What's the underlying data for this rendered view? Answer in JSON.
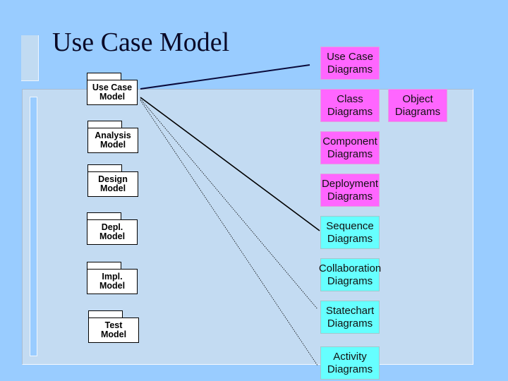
{
  "slide": {
    "title": "Use Case Model",
    "colors": {
      "background": "#99ccff",
      "panel": "#c3dbf2",
      "view_diagram": "#ff66ff",
      "behavior_diagram": "#66ffff"
    }
  },
  "models": [
    {
      "line1": "Use Case",
      "line2": "Model"
    },
    {
      "line1": "Analysis",
      "line2": "Model"
    },
    {
      "line1": "Design",
      "line2": "Model"
    },
    {
      "line1": "Depl.",
      "line2": "Model"
    },
    {
      "line1": "Impl.",
      "line2": "Model"
    },
    {
      "line1": "Test",
      "line2": "Model"
    }
  ],
  "diagrams": [
    {
      "line1": "Use Case",
      "line2": "Diagrams",
      "kind": "magenta"
    },
    {
      "line1": "Class",
      "line2": "Diagrams",
      "kind": "magenta"
    },
    {
      "line1": "Object",
      "line2": "Diagrams",
      "kind": "magenta"
    },
    {
      "line1": "Component",
      "line2": "Diagrams",
      "kind": "magenta"
    },
    {
      "line1": "Deployment",
      "line2": "Diagrams",
      "kind": "magenta"
    },
    {
      "line1": "Sequence",
      "line2": "Diagrams",
      "kind": "cyan"
    },
    {
      "line1": "Collaboration",
      "line2": "Diagrams",
      "kind": "cyan"
    },
    {
      "line1": "Statechart",
      "line2": "Diagrams",
      "kind": "cyan"
    },
    {
      "line1": "Activity",
      "line2": "Diagrams",
      "kind": "cyan"
    }
  ],
  "connections": [
    {
      "from": "Use Case Model",
      "to": "Use Case Diagrams",
      "style": "solid"
    },
    {
      "from": "Use Case Model",
      "to": "Sequence Diagrams",
      "style": "solid"
    },
    {
      "from": "Use Case Model",
      "to": "Statechart Diagrams",
      "style": "dotted"
    },
    {
      "from": "Use Case Model",
      "to": "Activity Diagrams",
      "style": "dotted"
    }
  ]
}
